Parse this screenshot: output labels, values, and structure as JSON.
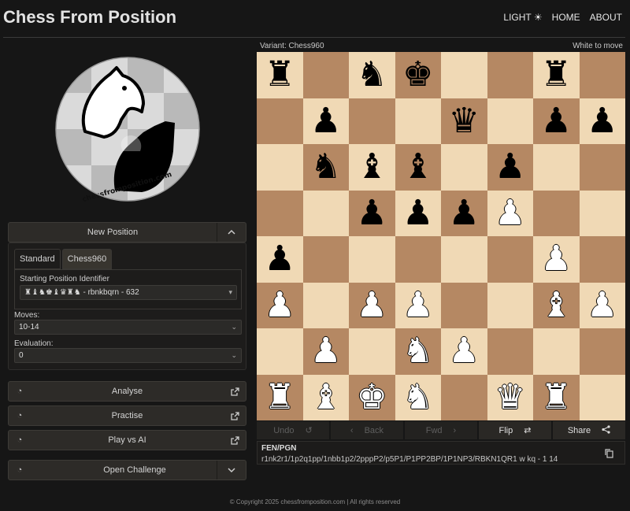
{
  "header": {
    "title": "Chess From Position",
    "nav": {
      "light": "LIGHT",
      "home": "HOME",
      "about": "ABOUT"
    }
  },
  "logo": {
    "text": "chessfromposition.com"
  },
  "new_position": {
    "label": "New Position"
  },
  "tabs": [
    {
      "label": "Standard",
      "active": false
    },
    {
      "label": "Chess960",
      "active": true
    }
  ],
  "spi": {
    "label": "Starting Position Identifier",
    "value": "♜♝♞♚♝♛♜♞ - rbnkbqrn - 632"
  },
  "moves": {
    "label": "Moves:",
    "value": "10-14"
  },
  "evaluation": {
    "label": "Evaluation:",
    "value": "0"
  },
  "actions": {
    "analyse": "Analyse",
    "practise": "Practise",
    "play_ai": "Play vs AI",
    "open_challenge": "Open Challenge"
  },
  "board": {
    "variant": "Variant: Chess960",
    "to_move": "White to move",
    "rows": [
      [
        "r",
        "",
        "n",
        "k",
        "",
        "",
        "r",
        ""
      ],
      [
        "",
        "p",
        "",
        "",
        "q",
        "",
        "p",
        "p"
      ],
      [
        "",
        "n",
        "b",
        "b",
        "",
        "p",
        "",
        ""
      ],
      [
        "",
        "",
        "p",
        "p",
        "p",
        "P",
        "",
        ""
      ],
      [
        "p",
        "",
        "",
        "",
        "",
        "",
        "P",
        ""
      ],
      [
        "P",
        "",
        "P",
        "P",
        "",
        "",
        "B",
        "P"
      ],
      [
        "",
        "P",
        "",
        "N",
        "P",
        "",
        "",
        ""
      ],
      [
        "R",
        "B",
        "K",
        "N",
        "",
        "Q",
        "R",
        ""
      ]
    ]
  },
  "controls": {
    "undo": "Undo",
    "back": "Back",
    "fwd": "Fwd",
    "flip": "Flip",
    "share": "Share"
  },
  "fen": {
    "heading": "FEN/PGN",
    "value": "r1nk2r1/1p2q1pp/1nbb1p2/2pppP2/p5P1/P1PP2BP/1P1NP3/RBKN1QR1 w kq - 1 14"
  },
  "footer": {
    "text": "© Copyright 2025 chessfromposition.com | All rights reserved"
  }
}
